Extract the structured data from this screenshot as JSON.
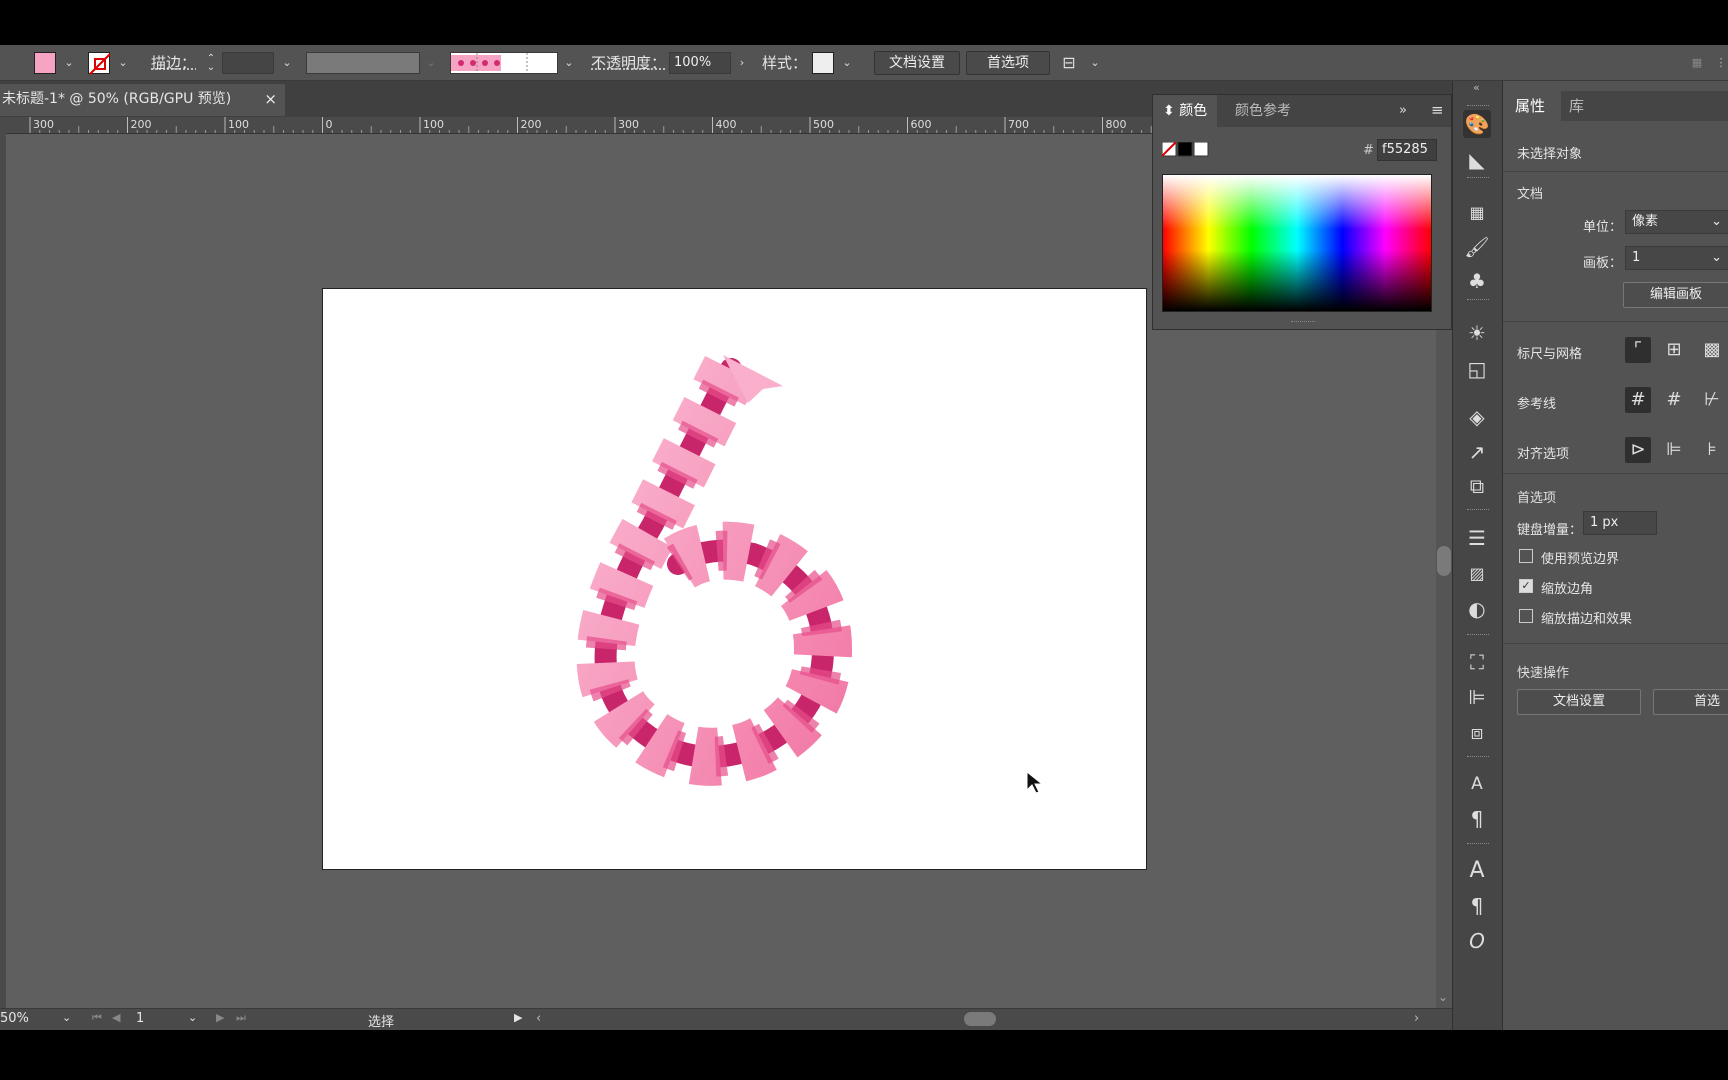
{
  "control_bar": {
    "stroke_label": "描边：",
    "opacity_label": "不透明度：",
    "opacity_value": "100%",
    "style_label": "样式：",
    "doc_setup_button": "文档设置",
    "prefs_button": "首选项"
  },
  "document_tab": {
    "title": "未标题-1* @ 50% (RGB/GPU 预览)",
    "close": "×"
  },
  "ruler": {
    "ticks": [
      "300",
      "200",
      "100",
      "0",
      "100",
      "200",
      "300",
      "400",
      "500",
      "600",
      "700",
      "800"
    ]
  },
  "status_bar": {
    "zoom": "50%",
    "page": "1",
    "tool": "选择"
  },
  "color_panel": {
    "tab_color": "颜色",
    "tab_guide": "颜色参考",
    "hex_label": "#",
    "hex_value": "f55285"
  },
  "properties_panel": {
    "tab_properties": "属性",
    "tab_library": "库",
    "no_selection": "未选择对象",
    "document_heading": "文档",
    "unit_label": "单位：",
    "unit_value": "像素",
    "artboard_label": "画板：",
    "artboard_value": "1",
    "edit_artboard_button": "编辑画板",
    "rulers_grids": "标尺与网格",
    "guides": "参考线",
    "align_options": "对齐选项",
    "preferences_heading": "首选项",
    "keyboard_increment_label": "键盘增量：",
    "keyboard_increment_value": "1 px",
    "use_preview_bounds": "使用预览边界",
    "scale_corners": "缩放边角",
    "scale_strokes": "缩放描边和效果",
    "quick_actions": "快速操作",
    "quick_doc_setup": "文档设置",
    "quick_prefs": "首选项"
  },
  "colors": {
    "fill": "#f7a3c3",
    "ribbon_light": "#f9a8c8",
    "ribbon_dark": "#e0357a"
  }
}
